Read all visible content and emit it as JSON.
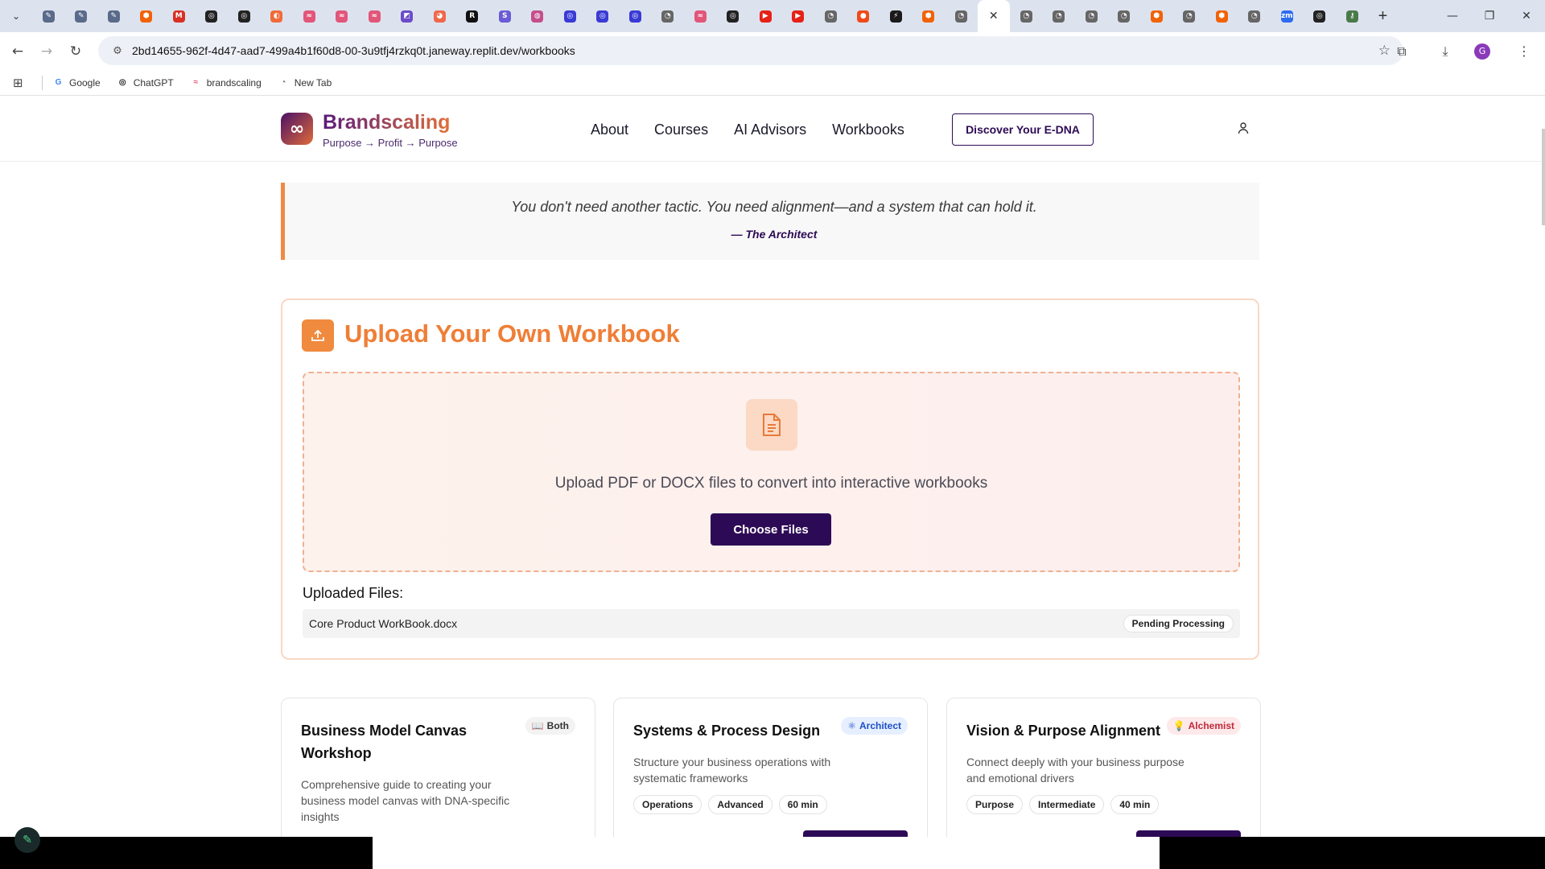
{
  "browser": {
    "tabs": [
      {
        "icon": "link-icon",
        "color": "#5a6a8a"
      },
      {
        "icon": "link-icon",
        "color": "#5a6a8a"
      },
      {
        "icon": "link-icon",
        "color": "#5a6a8a"
      },
      {
        "icon": "replit-icon",
        "color": "#f26207"
      },
      {
        "icon": "gmail-icon",
        "color": "#d93025"
      },
      {
        "icon": "openai-icon",
        "color": "#222"
      },
      {
        "icon": "openai-icon",
        "color": "#222"
      },
      {
        "icon": "orange-icon",
        "color": "#f26b3a"
      },
      {
        "icon": "spark-icon",
        "color": "#e2567a"
      },
      {
        "icon": "spark-icon",
        "color": "#e2567a"
      },
      {
        "icon": "spark-icon",
        "color": "#e2567a"
      },
      {
        "icon": "cursor-icon",
        "color": "#6b4cc8"
      },
      {
        "icon": "shape-icon",
        "color": "#f0684a"
      },
      {
        "icon": "r-icon",
        "color": "#111"
      },
      {
        "icon": "s-icon",
        "color": "#6b5bd6"
      },
      {
        "icon": "circle-icon",
        "color": "#c44e8c"
      },
      {
        "icon": "target-icon",
        "color": "#3a3ad6"
      },
      {
        "icon": "target-icon",
        "color": "#3a3ad6"
      },
      {
        "icon": "target-icon",
        "color": "#3a3ad6"
      },
      {
        "icon": "globe-icon",
        "color": "#666"
      },
      {
        "icon": "spark-icon",
        "color": "#e2567a"
      },
      {
        "icon": "openai-icon",
        "color": "#222"
      },
      {
        "icon": "youtube-icon",
        "color": "#e62117"
      },
      {
        "icon": "youtube-icon",
        "color": "#e62117"
      },
      {
        "icon": "globe-icon",
        "color": "#666"
      },
      {
        "icon": "red-dot-icon",
        "color": "#f04a1a"
      },
      {
        "icon": "chart-icon",
        "color": "#1a1a1a"
      },
      {
        "icon": "replit-icon",
        "color": "#f26207"
      },
      {
        "icon": "globe-icon",
        "color": "#666"
      },
      {
        "icon": "close-icon",
        "color": "#333",
        "active": true
      },
      {
        "icon": "globe-icon",
        "color": "#666"
      },
      {
        "icon": "globe-icon",
        "color": "#666"
      },
      {
        "icon": "globe-icon",
        "color": "#666"
      },
      {
        "icon": "globe-icon",
        "color": "#666"
      },
      {
        "icon": "replit-icon",
        "color": "#f26207"
      },
      {
        "icon": "globe-icon",
        "color": "#666"
      },
      {
        "icon": "replit-icon",
        "color": "#f26207"
      },
      {
        "icon": "globe-icon",
        "color": "#666"
      },
      {
        "icon": "zoom-icon",
        "color": "#2d6cf0"
      },
      {
        "icon": "openai-icon",
        "color": "#222"
      },
      {
        "icon": "key-icon",
        "color": "#4a7a4a"
      }
    ],
    "new_tab_glyph": "+",
    "url": "2bd14655-962f-4d47-aad7-499a4b1f60d8-00-3u9tfj4rzkq0t.janeway.replit.dev/workbooks",
    "profile_initial": "G",
    "bookmarks": [
      {
        "label": "Google",
        "icon": "google-icon",
        "color": "#4285f4",
        "glyph": "G"
      },
      {
        "label": "ChatGPT",
        "icon": "openai-icon",
        "color": "#222",
        "glyph": "◎"
      },
      {
        "label": "brandscaling",
        "icon": "spark-icon",
        "color": "#e2567a",
        "glyph": "≈"
      },
      {
        "label": "New Tab",
        "icon": "globe-icon",
        "color": "#666",
        "glyph": "◔"
      }
    ]
  },
  "site": {
    "brand": "Brandscaling",
    "tagline": "Purpose → Profit → Purpose",
    "logo_glyph": "∞",
    "nav": [
      "About",
      "Courses",
      "AI Advisors",
      "Workbooks"
    ],
    "cta": "Discover Your E-DNA"
  },
  "quote": {
    "text": "You don't need another tactic. You need alignment—and a system that can hold it.",
    "author": "— The Architect"
  },
  "upload": {
    "title": "Upload Your Own Workbook",
    "drop_text": "Upload PDF or DOCX files to convert into interactive workbooks",
    "button": "Choose Files",
    "uploaded_heading": "Uploaded Files:",
    "files": [
      {
        "name": "Core Product WorkBook.docx",
        "status": "Pending Processing"
      }
    ]
  },
  "cards": [
    {
      "title": "Business Model Canvas Workshop",
      "badge": "Both",
      "badge_icon": "book-icon",
      "badge_glyph": "📖",
      "badge_bg": "#f3f3f4",
      "badge_color": "#333",
      "description": "Comprehensive guide to creating your business model canvas with DNA-specific insights",
      "tags": []
    },
    {
      "title": "Systems & Process Design",
      "badge": "Architect",
      "badge_icon": "brain-icon",
      "badge_glyph": "⚛",
      "badge_bg": "#e6efff",
      "badge_color": "#1d4fc4",
      "description": "Structure your business operations with systematic frameworks",
      "tags": [
        "Operations",
        "Advanced",
        "60 min"
      ]
    },
    {
      "title": "Vision & Purpose Alignment",
      "badge": "Alchemist",
      "badge_icon": "lightbulb-icon",
      "badge_glyph": "💡",
      "badge_bg": "#fde8ea",
      "badge_color": "#c02a3a",
      "description": "Connect deeply with your business purpose and emotional drivers",
      "tags": [
        "Purpose",
        "Intermediate",
        "40 min"
      ]
    }
  ]
}
